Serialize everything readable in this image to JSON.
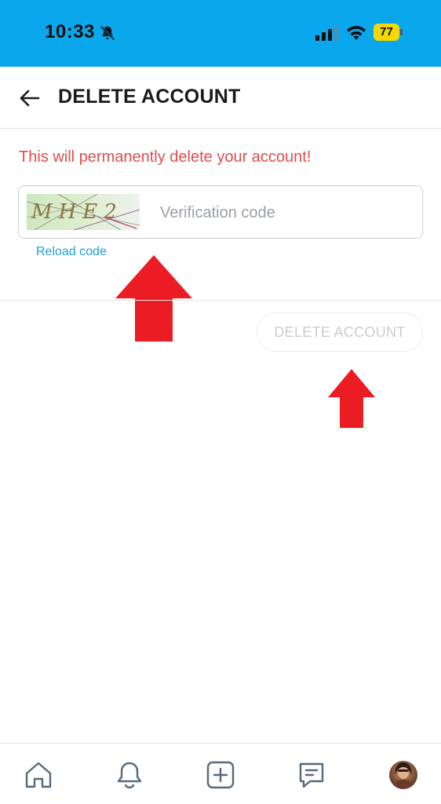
{
  "status_bar": {
    "time": "10:33",
    "battery": "77",
    "icons": [
      "bell-slash-icon",
      "signal-icon",
      "wifi-icon",
      "battery-icon"
    ]
  },
  "header": {
    "title": "DELETE ACCOUNT",
    "back_icon": "arrow-left-icon"
  },
  "content": {
    "warning": "This will permanently delete your account!",
    "captcha_text": "MHE2",
    "code_placeholder": "Verification code",
    "code_value": "",
    "reload_label": "Reload code",
    "delete_button_label": "DELETE ACCOUNT"
  },
  "bottom_nav": {
    "items": [
      "home-icon",
      "bell-icon",
      "plus-square-icon",
      "message-icon",
      "avatar"
    ]
  },
  "colors": {
    "status_bar": "#0aa7ec",
    "warning": "#e24b4b",
    "link": "#1aa0d8",
    "annotation_arrow": "#ec1c24",
    "battery": "#f5d800"
  }
}
